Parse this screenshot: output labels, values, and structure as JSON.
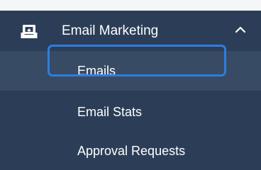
{
  "menu": {
    "group": {
      "label": "Email Marketing",
      "icon": "inbox-tray-icon",
      "expanded": true,
      "chevron_icon": "chevron-up-icon"
    },
    "items": [
      {
        "label": "Emails",
        "active": true,
        "focused": true
      },
      {
        "label": "Email Stats",
        "active": false
      },
      {
        "label": "Approval Requests",
        "active": false
      }
    ]
  },
  "colors": {
    "sidebar_bg": "#2c3e57",
    "active_bg": "#384b64",
    "focus_ring": "#2f7de1",
    "text": "#ffffff"
  }
}
